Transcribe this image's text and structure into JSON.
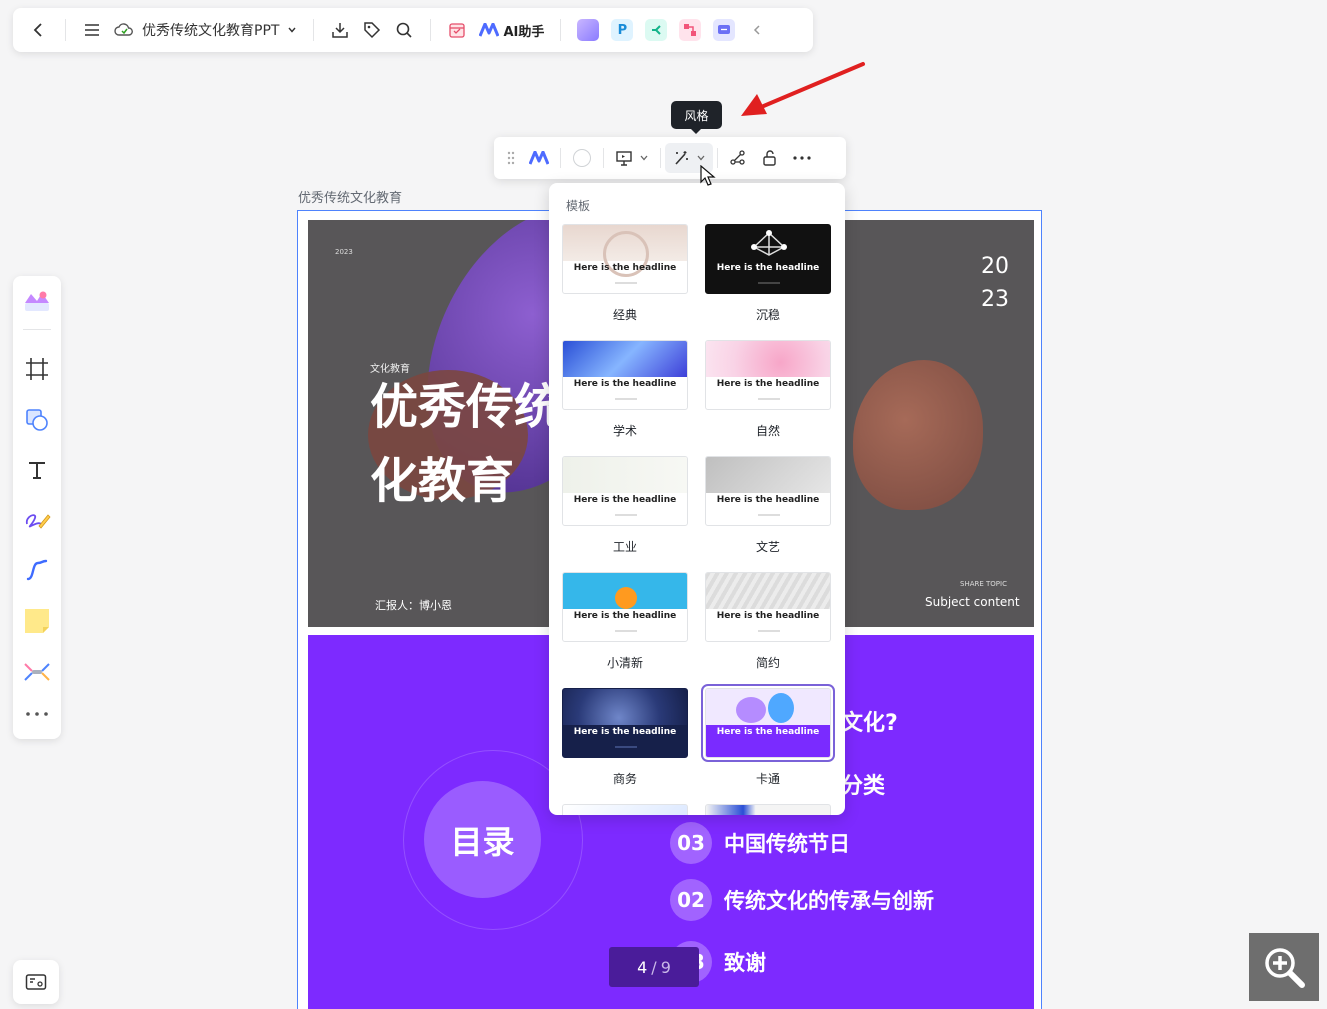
{
  "topbar": {
    "doc_title": "优秀传统文化教育PPT",
    "ai_label": "AI助手"
  },
  "tooltip": "风格",
  "board": {
    "label": "优秀传统文化教育"
  },
  "slide1": {
    "year_small": "2023",
    "year_top": "20",
    "year_bottom": "23",
    "subtitle": "文化教育",
    "title_line1": "优秀传统",
    "title_line2": "化教育",
    "reporter": "汇报人：博小恩",
    "share_topic": "SHARE TOPIC",
    "subject": "Subject content"
  },
  "slide2": {
    "center": "目录",
    "frag1": "文化?",
    "frag2": "分类",
    "items": [
      {
        "num": "03",
        "text": "中国传统节日"
      },
      {
        "num": "02",
        "text": "传统文化的传承与创新"
      },
      {
        "num": "03",
        "text": "致谢"
      }
    ]
  },
  "pager": {
    "current": "4",
    "separator": "/",
    "total": "9"
  },
  "dropdown": {
    "title": "模板",
    "templates": [
      {
        "name": "经典",
        "headline": "Here is the headline"
      },
      {
        "name": "沉稳",
        "headline": "Here is the headline"
      },
      {
        "name": "学术",
        "headline": "Here is the headline"
      },
      {
        "name": "自然",
        "headline": "Here is the headline"
      },
      {
        "name": "工业",
        "headline": "Here is the headline"
      },
      {
        "name": "文艺",
        "headline": "Here is the headline"
      },
      {
        "name": "小清新",
        "headline": "Here is the headline"
      },
      {
        "name": "简约",
        "headline": "Here is the headline"
      },
      {
        "name": "商务",
        "headline": "Here is the headline"
      },
      {
        "name": "卡通",
        "headline": "Here is the headline"
      }
    ],
    "selected": "卡通"
  },
  "colors": {
    "accent": "#4e83fd",
    "slide_purple": "#7d2aff",
    "arrow_red": "#e02020"
  }
}
